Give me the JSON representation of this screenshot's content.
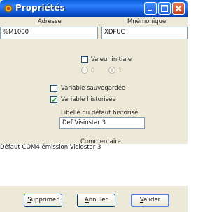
{
  "window": {
    "title": "Propriétés"
  },
  "fields": {
    "adresse_label": "Adresse",
    "adresse_value": "%M1000",
    "mnemonique_label": "Mnémonique",
    "mnemonique_value": "XDFUC"
  },
  "valeur_initiale": {
    "label": "Valeur initiale",
    "checked": false,
    "radio_0": "0",
    "radio_1": "1",
    "selected": "1"
  },
  "variable_sauvegardee": {
    "label": "Variable sauvegardée",
    "checked": false
  },
  "variable_historisee": {
    "label": "Variable historisée",
    "checked": true
  },
  "libelle": {
    "label": "Libellé du défaut historisé",
    "value": "Def Visiostar 3"
  },
  "commentaire": {
    "label": "Commentaire",
    "value": "Défaut COM4 émission Visiostar 3"
  },
  "buttons": {
    "supprimer_first": "S",
    "supprimer_rest": "upprimer",
    "annuler_first": "A",
    "annuler_rest": "nnuler",
    "valider_first": "V",
    "valider_rest": "alider"
  },
  "colors": {
    "titlebar": "#0a5fd8",
    "window_bg": "#ece9d8",
    "checkmark": "#21a121"
  }
}
